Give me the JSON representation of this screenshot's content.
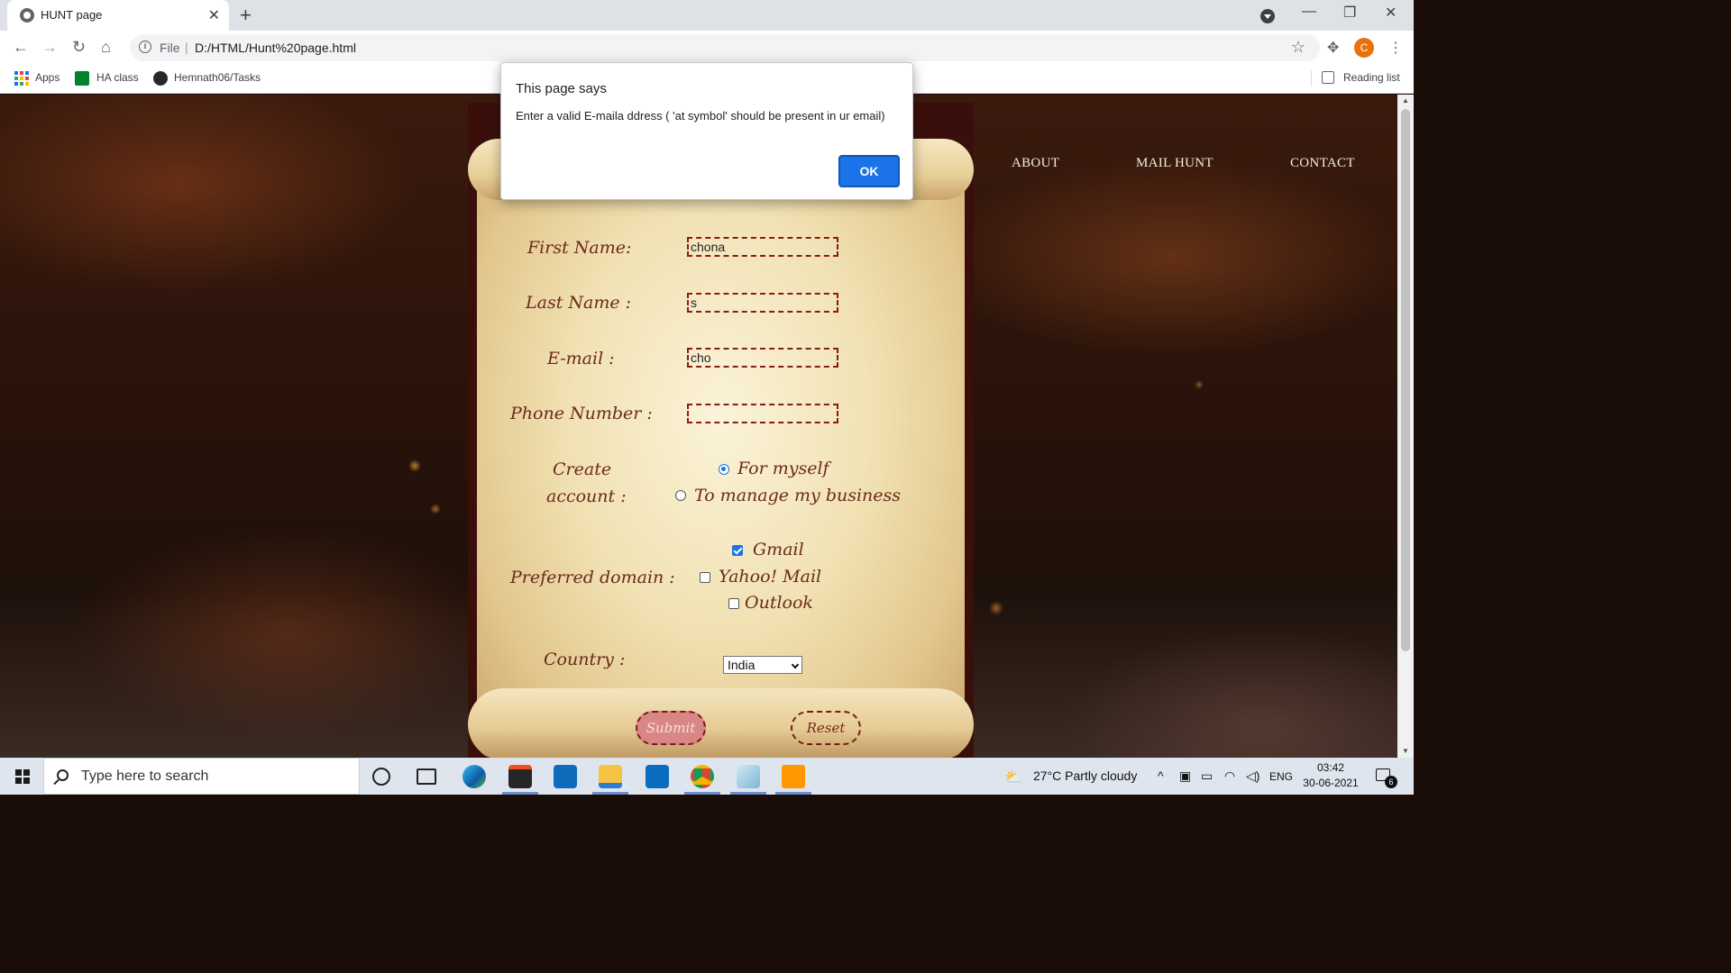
{
  "browser": {
    "tab_title": "HUNT page",
    "tab_close": "✕",
    "new_tab": "+",
    "url_scheme": "File",
    "url_separator": "|",
    "url": "D:/HTML/Hunt%20page.html",
    "window_controls": {
      "minimize": "—",
      "maximize": "❐",
      "close": "✕"
    },
    "nav": {
      "back": "←",
      "forward": "→",
      "reload": "↻",
      "home": "⌂",
      "star": "☆",
      "extensions": "✥",
      "menu": "⋮"
    },
    "profile_initial": "C",
    "bookmarks": [
      {
        "label": "Apps",
        "icon": "apps-grid-icon"
      },
      {
        "label": "HA class",
        "icon": "google-meet-icon"
      },
      {
        "label": "Hemnath06/Tasks",
        "icon": "github-icon"
      }
    ],
    "reading_list": "Reading list"
  },
  "page": {
    "nav_links": [
      "ABOUT",
      "MAIL HUNT",
      "CONTACT"
    ],
    "form": {
      "first_name_label": "First Name:",
      "first_name_value": "chona",
      "last_name_label": "Last Name :",
      "last_name_value": "s",
      "email_label": "E-mail :",
      "email_value": "cho",
      "phone_label": "Phone Number :",
      "phone_value": "",
      "create_account_label_line1": "Create",
      "create_account_label_line2": "account :",
      "create_account_options": [
        {
          "label": "For myself",
          "selected": true
        },
        {
          "label": "To manage my business",
          "selected": false
        }
      ],
      "domain_label": "Preferred domain :",
      "domain_options": [
        {
          "label": "Gmail",
          "checked": true
        },
        {
          "label": "Yahoo! Mail",
          "checked": false
        },
        {
          "label": "Outlook",
          "checked": false
        }
      ],
      "country_label": "Country :",
      "country_value": "India",
      "submit_label": "Submit",
      "reset_label": "Reset"
    }
  },
  "dialog": {
    "title": "This page says",
    "message": "Enter a valid E-maila ddress ( 'at symbol' should be present in ur email)",
    "ok_label": "OK"
  },
  "taskbar": {
    "search_placeholder": "Type here to search",
    "weather": "27°C  Partly cloudy",
    "language": "ENG",
    "time": "03:42",
    "date": "30-06-2021",
    "notification_count": "6",
    "apps": [
      "cortana-icon",
      "task-view-icon",
      "edge-icon",
      "store-icon",
      "mail-icon",
      "file-explorer-icon",
      "dell-icon",
      "chrome-icon",
      "notepad-icon",
      "sublime-text-icon"
    ]
  },
  "colors": {
    "accent": "#1a73e8",
    "field_border": "#8a1d12",
    "label_text": "#6b2a1c",
    "submit_bg": "#d98686"
  }
}
